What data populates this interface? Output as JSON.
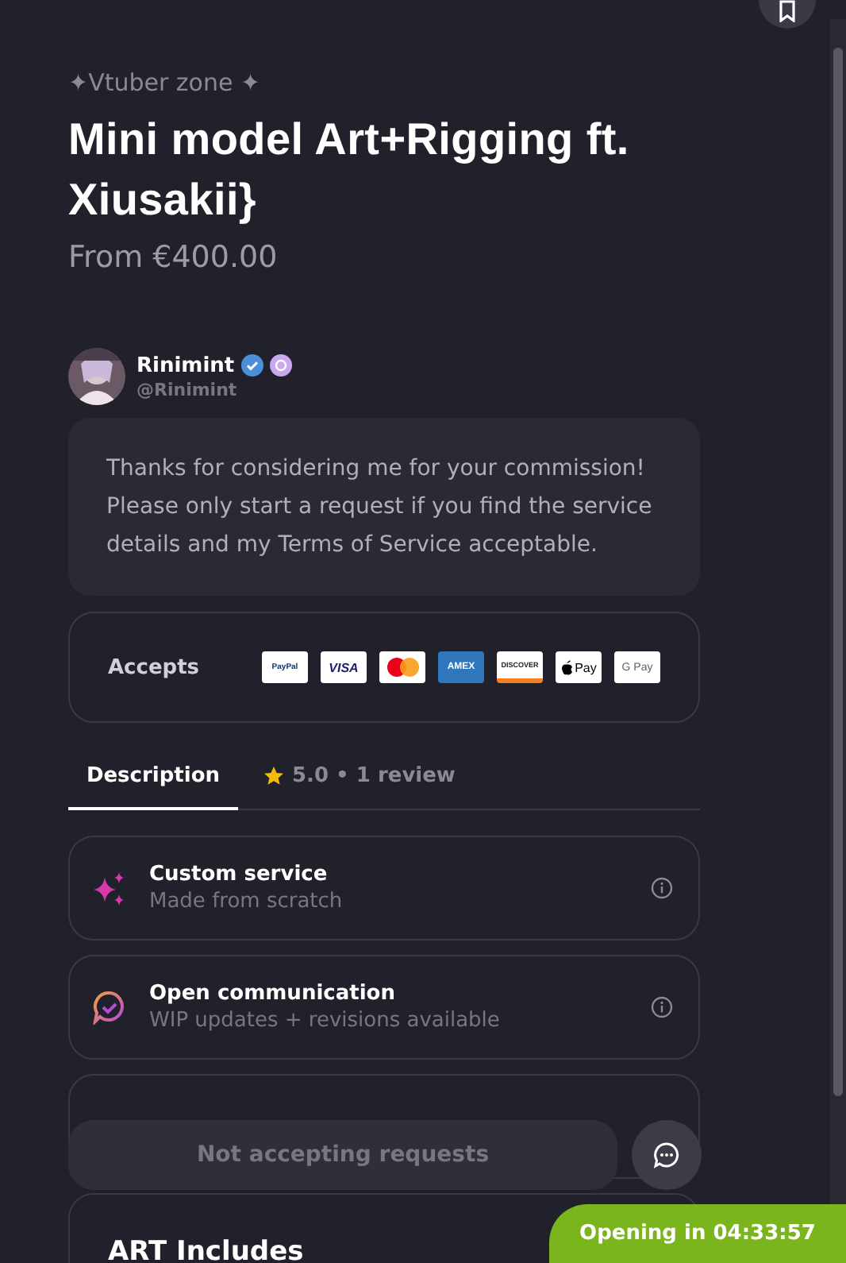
{
  "category": "✦Vtuber zone ✦",
  "title": "Mini model Art+Rigging ft. Xiusakii}",
  "price": "From €400.00",
  "artist": {
    "name": "Rinimint",
    "handle": "@Rinimint",
    "verified": true
  },
  "intro": "Thanks for considering me for your commission! Please only start a request if you find the service details and my Terms of Service acceptable.",
  "payments": {
    "label": "Accepts",
    "methods": [
      {
        "kind": "paypal",
        "label": "PayPal"
      },
      {
        "kind": "visa",
        "label": "VISA"
      },
      {
        "kind": "mastercard"
      },
      {
        "kind": "amex",
        "label": "AMEX"
      },
      {
        "kind": "discover",
        "label": "DISCOVER"
      },
      {
        "kind": "applepay",
        "label": "Pay"
      },
      {
        "kind": "gpay",
        "label": "G Pay"
      }
    ]
  },
  "tabs": [
    {
      "label": "Description",
      "selected": true,
      "kind": "text"
    },
    {
      "label": "5.0 • 1 review",
      "selected": false,
      "kind": "rating"
    }
  ],
  "features": [
    {
      "kind": "sparkle",
      "title": "Custom service",
      "subtitle": "Made from scratch"
    },
    {
      "kind": "chat",
      "title": "Open communication",
      "subtitle": "WIP updates + revisions available"
    },
    {
      "kind": "hidden"
    }
  ],
  "section": {
    "title": "ART Includes"
  },
  "request_button": {
    "label": "Not accepting requests",
    "disabled": true
  },
  "opening": {
    "label": "Opening in 04:33:57"
  }
}
